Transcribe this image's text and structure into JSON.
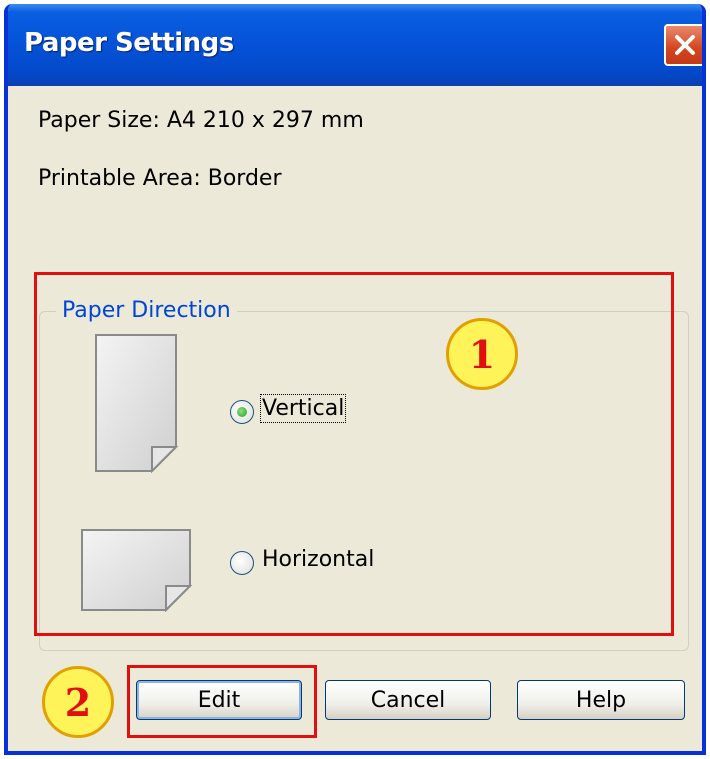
{
  "window": {
    "title": "Paper Settings"
  },
  "info": {
    "paper_size": "Paper Size:  A4 210 x 297 mm",
    "printable_area": "Printable Area:  Border"
  },
  "group": {
    "label": "Paper Direction",
    "options": [
      {
        "label": "Vertical",
        "selected": true
      },
      {
        "label": "Horizontal",
        "selected": false
      }
    ]
  },
  "annotations": {
    "badge1": "1",
    "badge2": "2"
  },
  "buttons": {
    "edit": "Edit",
    "cancel": "Cancel",
    "help": "Help"
  },
  "colors": {
    "titlebar": "#0552d8",
    "dialog_bg": "#ece9d8",
    "highlight_red": "#e01010",
    "badge_fill": "#fff35a",
    "group_label": "#0046d5"
  }
}
